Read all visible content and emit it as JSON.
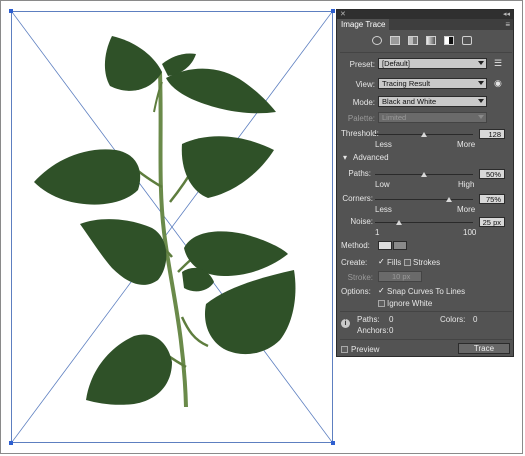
{
  "panel": {
    "title": "Image Trace",
    "close_glyph": "✕",
    "collapse_glyph": "◂◂",
    "menu_glyph": "≡",
    "preset_icons": [
      "auto-color-icon",
      "high-color-icon",
      "low-color-icon",
      "grayscale-icon",
      "black-and-white-icon",
      "outline-icon"
    ],
    "preset": {
      "label": "Preset:",
      "value": "[Default]",
      "icon": "preset-list-icon"
    },
    "view": {
      "label": "View:",
      "value": "Tracing Result",
      "icon": "eye-icon"
    },
    "mode": {
      "label": "Mode:",
      "value": "Black and White"
    },
    "palette": {
      "label": "Palette:",
      "value": "Limited"
    },
    "threshold": {
      "label": "Threshold:",
      "value": "128",
      "min_label": "Less",
      "max_label": "More",
      "level": 0.5
    },
    "advanced": {
      "label": "Advanced",
      "toggle": "▾"
    },
    "paths": {
      "label": "Paths:",
      "value": "50%",
      "min_label": "Low",
      "max_label": "High",
      "level": 0.5
    },
    "corners": {
      "label": "Corners:",
      "value": "75%",
      "min_label": "Less",
      "max_label": "More",
      "level": 0.75
    },
    "noise": {
      "label": "Noise:",
      "value": "25 px",
      "min_label": "1",
      "max_label": "100",
      "level": 0.24
    },
    "method": {
      "label": "Method:"
    },
    "create": {
      "label": "Create:",
      "fills_label": "Fills",
      "fills_checked": true,
      "strokes_label": "Strokes",
      "strokes_checked": false
    },
    "stroke": {
      "label": "Stroke:",
      "value": "10 px"
    },
    "options": {
      "label": "Options:",
      "snap_label": "Snap Curves To Lines",
      "snap_checked": true,
      "ignore_white_label": "Ignore White",
      "ignore_white_checked": false
    },
    "stats": {
      "paths_label": "Paths:",
      "paths_value": "0",
      "colors_label": "Colors:",
      "colors_value": "0",
      "anchors_label": "Anchors:",
      "anchors_value": "0"
    },
    "preview": {
      "label": "Preview",
      "checked": false
    },
    "trace_button": "Trace",
    "check_glyph": "✓",
    "info_glyph": "i"
  },
  "colors": {
    "panel_bg": "#535353",
    "leaf": "#2f5128",
    "stem": "#6a8a4a",
    "guide": "#5d7fc0"
  }
}
